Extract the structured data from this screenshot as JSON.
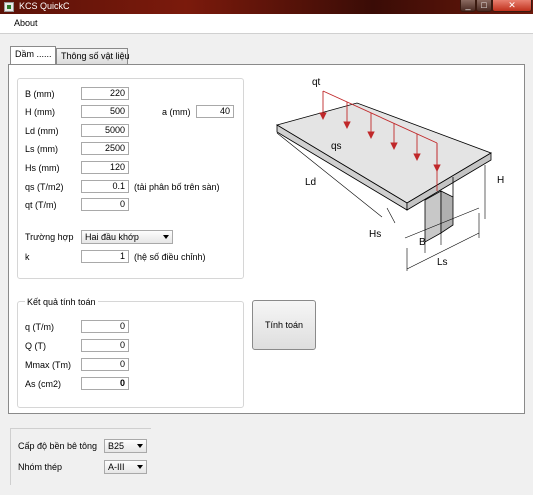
{
  "window": {
    "title": "KCS QuickC",
    "minimize_glyph": "_",
    "maximize_glyph": "□",
    "close_glyph": "✕"
  },
  "menu": {
    "about": "About"
  },
  "tabs": [
    {
      "label": "Dầm ......",
      "active": true
    },
    {
      "label": "Thông số vật liệu",
      "active": false
    }
  ],
  "inputs": {
    "B": {
      "label": "B (mm)",
      "value": "220"
    },
    "H": {
      "label": "H (mm)",
      "value": "500"
    },
    "a": {
      "label": "a (mm)",
      "value": "40"
    },
    "Ld": {
      "label": "Ld (mm)",
      "value": "5000"
    },
    "Ls": {
      "label": "Ls (mm)",
      "value": "2500"
    },
    "Hs": {
      "label": "Hs (mm)",
      "value": "120"
    },
    "qs": {
      "label": "qs (T/m2)",
      "value": "0.1",
      "note": "(tải phân bố trên sàn)"
    },
    "qt": {
      "label": "qt (T/m)",
      "value": "0"
    },
    "case": {
      "label": "Trường hợp",
      "value": "Hai đầu khớp"
    },
    "k": {
      "label": "k",
      "value": "1",
      "note": "(hệ số điều chỉnh)"
    }
  },
  "results": {
    "title": "Kết quả tính toán",
    "q": {
      "label": "q (T/m)",
      "value": "0"
    },
    "Q": {
      "label": "Q (T)",
      "value": "0"
    },
    "Mmax": {
      "label": "Mmax (Tm)",
      "value": "0"
    },
    "As": {
      "label": "As (cm2)",
      "value": "0"
    }
  },
  "calc_button": "Tính toán",
  "diagram": {
    "qt": "qt",
    "qs": "qs",
    "Ld": "Ld",
    "H": "H",
    "Hs": "Hs",
    "B": "B",
    "Ls": "Ls",
    "load_color": "#c0282a"
  },
  "materials": {
    "concrete": {
      "label": "Cấp độ bền bê tông",
      "value": "B25"
    },
    "steel": {
      "label": "Nhóm thép",
      "value": "A-III"
    }
  }
}
